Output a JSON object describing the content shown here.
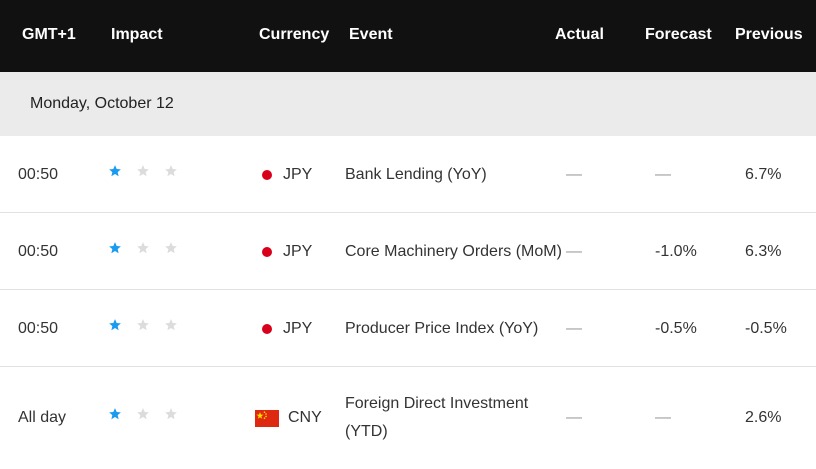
{
  "header": {
    "timezone": "GMT+1",
    "impact": "Impact",
    "currency": "Currency",
    "event": "Event",
    "actual": "Actual",
    "forecast": "Forecast",
    "previous": "Previous"
  },
  "day_label": "Monday, October 12",
  "colors": {
    "header_bg": "#111111",
    "star_active": "#1a9bf0",
    "star_inactive": "#dcdcdc",
    "jpy_red": "#d9001b",
    "cny_red": "#de2910"
  },
  "rows": [
    {
      "time": "00:50",
      "impact": 1,
      "currency": "JPY",
      "flag": "jp-flag-icon",
      "event": "Bank Lending (YoY)",
      "actual": "—",
      "forecast": "—",
      "previous": "6.7%"
    },
    {
      "time": "00:50",
      "impact": 1,
      "currency": "JPY",
      "flag": "jp-flag-icon",
      "event": "Core Machinery Orders (MoM)",
      "actual": "—",
      "forecast": "-1.0%",
      "previous": "6.3%"
    },
    {
      "time": "00:50",
      "impact": 1,
      "currency": "JPY",
      "flag": "jp-flag-icon",
      "event": "Producer Price Index (YoY)",
      "actual": "—",
      "forecast": "-0.5%",
      "previous": "-0.5%"
    },
    {
      "time": "All day",
      "impact": 1,
      "currency": "CNY",
      "flag": "cn-flag-icon",
      "event": "Foreign Direct Investment (YTD)",
      "actual": "—",
      "forecast": "—",
      "previous": "2.6%"
    }
  ]
}
